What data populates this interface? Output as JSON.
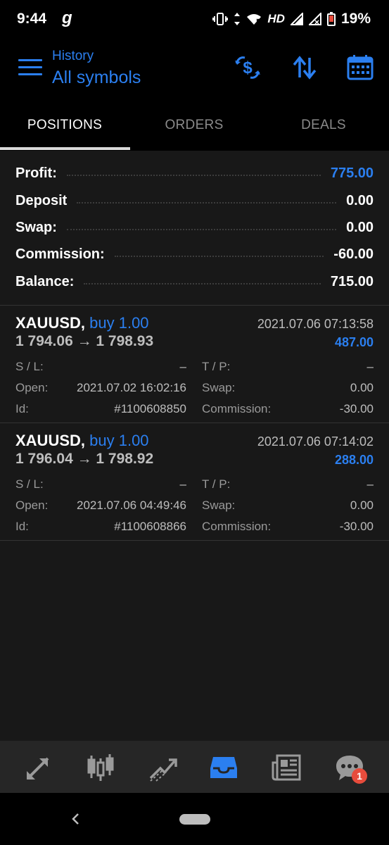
{
  "status_bar": {
    "time": "9:44",
    "g_icon": "g",
    "hd": "HD",
    "battery": "19%",
    "icons": [
      "vibrate-icon",
      "data-arrows-icon",
      "wifi-icon",
      "signal-icon",
      "signal-x-icon",
      "battery-low-icon"
    ]
  },
  "header": {
    "subtitle": "History",
    "title": "All symbols",
    "icons": [
      "currency-exchange-icon",
      "sort-icon",
      "calendar-icon"
    ]
  },
  "tabs": [
    {
      "label": "POSITIONS",
      "active": true
    },
    {
      "label": "ORDERS",
      "active": false
    },
    {
      "label": "DEALS",
      "active": false
    }
  ],
  "summary": {
    "profit_label": "Profit:",
    "profit_value": "775.00",
    "deposit_label": "Deposit",
    "deposit_value": "0.00",
    "swap_label": "Swap:",
    "swap_value": "0.00",
    "commission_label": "Commission:",
    "commission_value": "-60.00",
    "balance_label": "Balance:",
    "balance_value": "715.00"
  },
  "positions": [
    {
      "symbol": "XAUUSD,",
      "type": "buy 1.00",
      "close_time": "2021.07.06 07:13:58",
      "prices": "1 794.06 → 1 798.93",
      "profit": "487.00",
      "sl_label": "S / L:",
      "sl_value": "–",
      "tp_label": "T / P:",
      "tp_value": "–",
      "open_label": "Open:",
      "open_value": "2021.07.02 16:02:16",
      "swap_label": "Swap:",
      "swap_value": "0.00",
      "id_label": "Id:",
      "id_value": "#1100608850",
      "commission_label": "Commission:",
      "commission_value": "-30.00"
    },
    {
      "symbol": "XAUUSD,",
      "type": "buy 1.00",
      "close_time": "2021.07.06 07:14:02",
      "prices": "1 796.04 → 1 798.92",
      "profit": "288.00",
      "sl_label": "S / L:",
      "sl_value": "–",
      "tp_label": "T / P:",
      "tp_value": "–",
      "open_label": "Open:",
      "open_value": "2021.07.06 04:49:46",
      "swap_label": "Swap:",
      "swap_value": "0.00",
      "id_label": "Id:",
      "id_value": "#1100608866",
      "commission_label": "Commission:",
      "commission_value": "-30.00"
    }
  ],
  "bottom_nav": {
    "items": [
      "quotes-icon",
      "chart-icon",
      "trade-icon",
      "history-icon",
      "news-icon",
      "chat-icon"
    ],
    "active": "history-icon",
    "chat_badge": "1"
  },
  "colors": {
    "accent": "#2b7ff0",
    "background": "#181818",
    "header_bg": "#000000",
    "badge": "#e74c3c"
  }
}
